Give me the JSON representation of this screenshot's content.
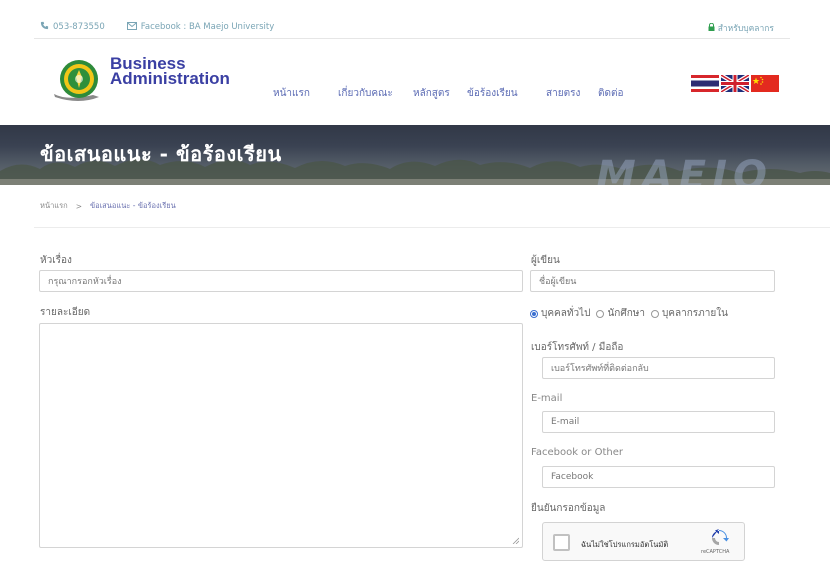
{
  "topbar": {
    "phone": "053-873550",
    "facebook": "Facebook : BA Maejo University",
    "staff": "สำหรับบุคลากร"
  },
  "brand": {
    "line1": "Business",
    "line2": "Administration"
  },
  "nav": {
    "items": [
      {
        "label": "หน้าแรก"
      },
      {
        "label": "เกี่ยวกับคณะ"
      },
      {
        "label": "หลักสูตร"
      },
      {
        "label": "ข้อร้องเรียน"
      },
      {
        "label": "สายตรง"
      },
      {
        "label": "ติดต่อ"
      }
    ]
  },
  "banner": {
    "title": "ข้อเสนอแนะ - ข้อร้องเรียน",
    "watermark": "MAEJO"
  },
  "breadcrumb": {
    "home": "หน้าแรก",
    "separator": ">",
    "current": "ข้อเสนอแนะ - ข้อร้องเรียน"
  },
  "form": {
    "subject_label": "หัวเรื่อง",
    "subject_placeholder": "กรุณากรอกหัวเรื่อง",
    "detail_label": "รายละเอียด",
    "author_label": "ผู้เขียน",
    "author_placeholder": "ชื่อผู้เขียน",
    "radio_options": [
      {
        "label": "บุคคลทั่วไป",
        "selected": true
      },
      {
        "label": "นักศึกษา",
        "selected": false
      },
      {
        "label": "บุคลากรภายใน",
        "selected": false
      }
    ],
    "phone_label": "เบอร์โทรศัพท์ / มือถือ",
    "phone_placeholder": "เบอร์โทรศัพท์ที่ติดต่อกลับ",
    "email_label": "E-mail",
    "email_placeholder": "E-mail",
    "facebook_label": "Facebook or Other",
    "facebook_placeholder": "Facebook",
    "confirm_label": "ยืนยันกรอกข้อมูล"
  },
  "captcha": {
    "text": "ฉันไม่ใช่โปรแกรมอัตโนมัติ",
    "brand": "reCAPTCHA"
  },
  "icons": {
    "phone": "phone-icon",
    "mail": "mail-icon",
    "lock": "lock-icon"
  },
  "colors": {
    "accent_blue": "#5b6bb4",
    "brand_blue": "#3a3fa3",
    "contact_teal": "#7aa5b5"
  }
}
